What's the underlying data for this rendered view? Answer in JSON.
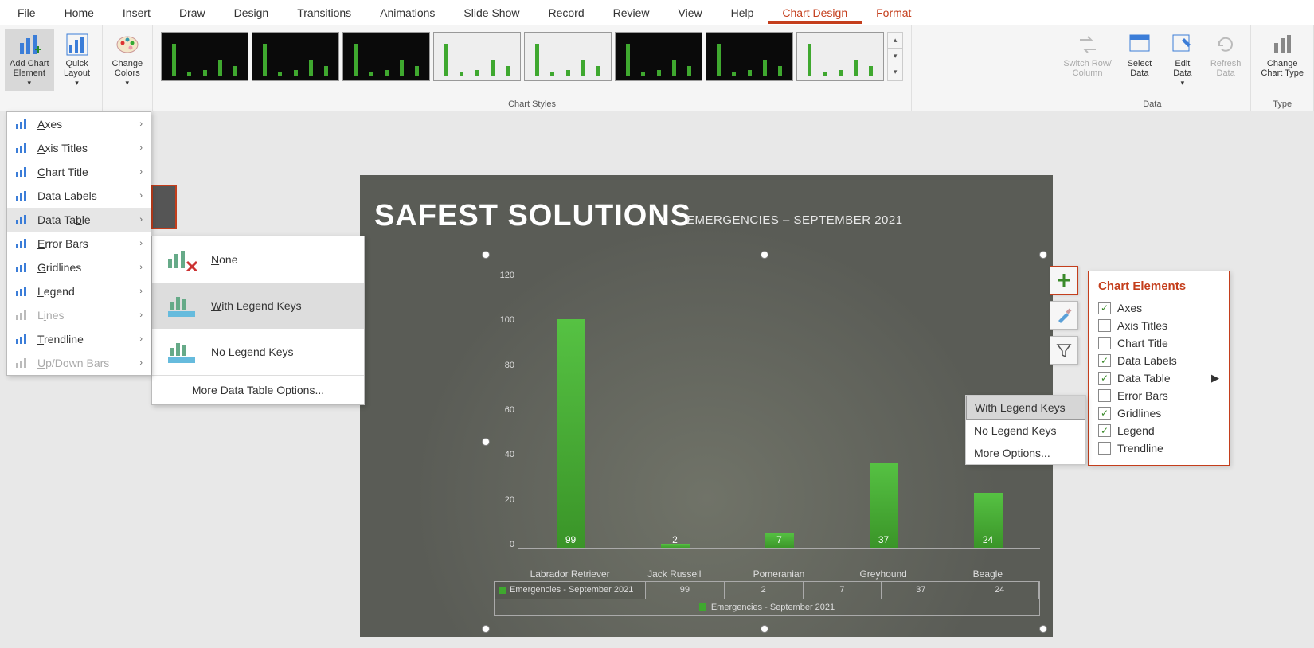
{
  "ribbon_tabs": [
    "File",
    "Home",
    "Insert",
    "Draw",
    "Design",
    "Transitions",
    "Animations",
    "Slide Show",
    "Record",
    "Review",
    "View",
    "Help",
    "Chart Design",
    "Format"
  ],
  "active_tab_index": 12,
  "groups": {
    "chart_layouts": {
      "add_chart_element": "Add Chart\nElement",
      "quick_layout": "Quick\nLayout"
    },
    "change_colors": "Change\nColors",
    "chart_styles_label": "Chart Styles",
    "data": {
      "switch": "Switch Row/\nColumn",
      "select": "Select\nData",
      "edit": "Edit\nData",
      "refresh": "Refresh\nData",
      "label": "Data"
    },
    "type": {
      "change": "Change\nChart Type",
      "label": "Type"
    }
  },
  "add_element_menu": [
    {
      "label": "Axes",
      "key": "A",
      "enabled": true
    },
    {
      "label": "Axis Titles",
      "key": "A",
      "enabled": true
    },
    {
      "label": "Chart Title",
      "key": "C",
      "enabled": true
    },
    {
      "label": "Data Labels",
      "key": "D",
      "enabled": true
    },
    {
      "label": "Data Table",
      "key": "B",
      "enabled": true,
      "hover": true
    },
    {
      "label": "Error Bars",
      "key": "E",
      "enabled": true
    },
    {
      "label": "Gridlines",
      "key": "G",
      "enabled": true
    },
    {
      "label": "Legend",
      "key": "L",
      "enabled": true
    },
    {
      "label": "Lines",
      "key": "I",
      "enabled": false
    },
    {
      "label": "Trendline",
      "key": "T",
      "enabled": true
    },
    {
      "label": "Up/Down Bars",
      "key": "U",
      "enabled": false
    }
  ],
  "data_table_submenu": {
    "none": "None",
    "with_keys": "With Legend Keys",
    "no_keys": "No Legend Keys",
    "more": "More Data Table Options..."
  },
  "slide": {
    "title": "SAFEST SOLUTIONS",
    "subtitle": "EMERGENCIES – SEPTEMBER 2021"
  },
  "chart_data": {
    "type": "bar",
    "categories": [
      "Labrador Retriever",
      "Jack Russell",
      "Pomeranian",
      "Greyhound",
      "Beagle"
    ],
    "values": [
      99,
      2,
      7,
      37,
      24
    ],
    "series_name": "Emergencies - September 2021",
    "ylabel": "",
    "ylim": [
      0,
      120
    ],
    "yticks": [
      0,
      20,
      40,
      60,
      80,
      100,
      120
    ],
    "data_table_header": "Emergencies - September 2021",
    "legend_text": "Emergencies - September 2021"
  },
  "chart_elements_panel": {
    "title": "Chart Elements",
    "items": [
      {
        "label": "Axes",
        "checked": true
      },
      {
        "label": "Axis Titles",
        "checked": false
      },
      {
        "label": "Chart Title",
        "checked": false
      },
      {
        "label": "Data Labels",
        "checked": true
      },
      {
        "label": "Data Table",
        "checked": true,
        "expand": true
      },
      {
        "label": "Error Bars",
        "checked": false
      },
      {
        "label": "Gridlines",
        "checked": true
      },
      {
        "label": "Legend",
        "checked": true
      },
      {
        "label": "Trendline",
        "checked": false
      }
    ]
  },
  "dt_float_submenu": {
    "with_keys": "With Legend Keys",
    "no_keys": "No Legend Keys",
    "more": "More Options..."
  }
}
